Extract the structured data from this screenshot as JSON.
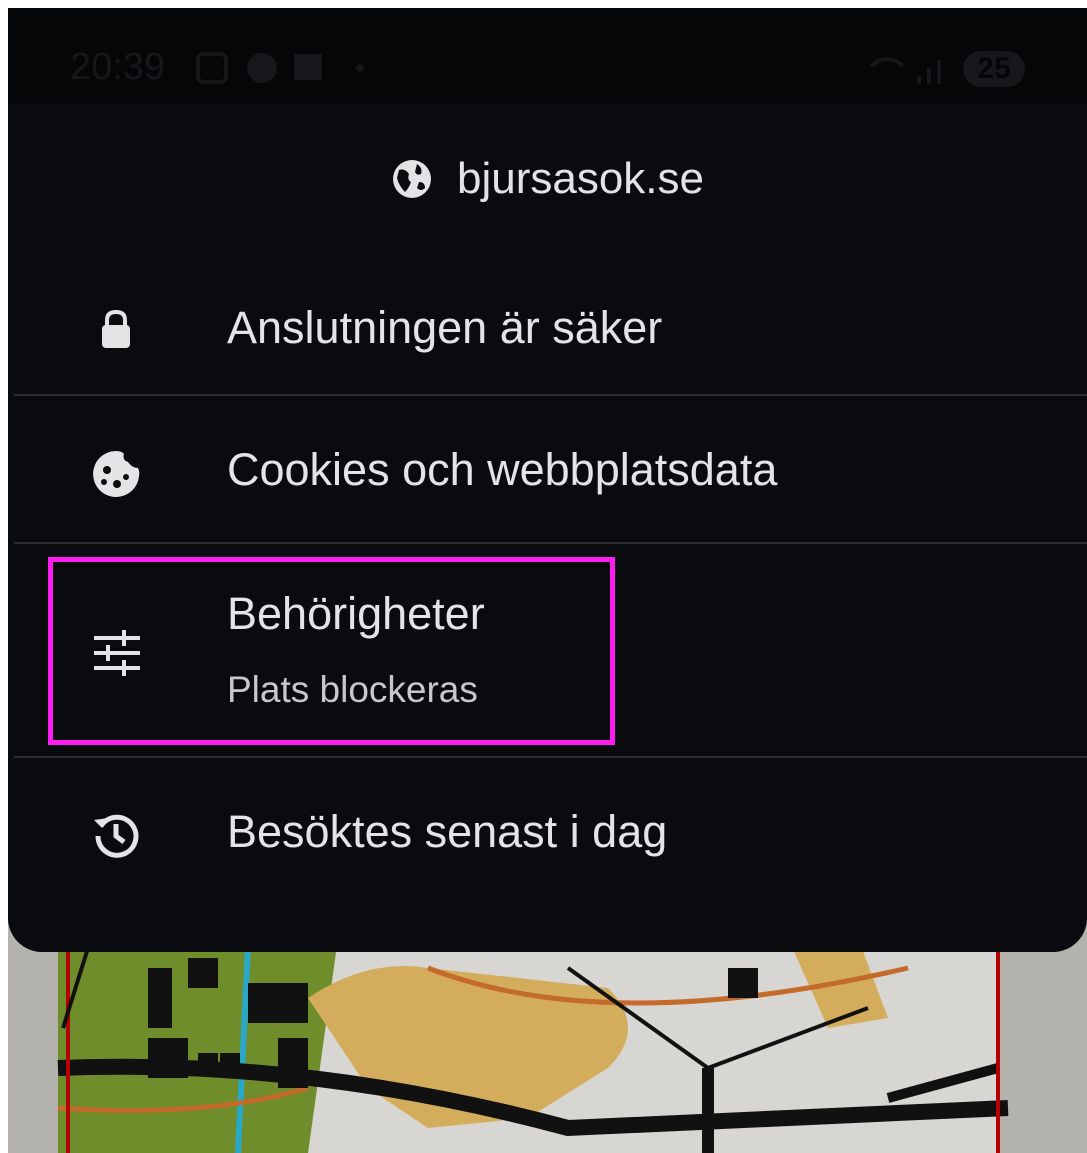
{
  "status_bar": {
    "time": "20:39",
    "battery": "25"
  },
  "page_info": {
    "site": "bjursasok.se",
    "site_icon": "globe-icon",
    "items": [
      {
        "label": "Anslutningen är säker",
        "icon": "lock-icon"
      },
      {
        "label": "Cookies och webbplatsdata",
        "icon": "cookie-icon"
      },
      {
        "label": "Behörigheter",
        "sublabel": "Plats blockeras",
        "icon": "tune-icon"
      },
      {
        "label": "Besöktes senast i dag",
        "icon": "history-icon"
      }
    ]
  },
  "colors": {
    "sheet_background": "#090b0f",
    "highlight": "#ff1cf0",
    "text": "#e4e4e7"
  }
}
